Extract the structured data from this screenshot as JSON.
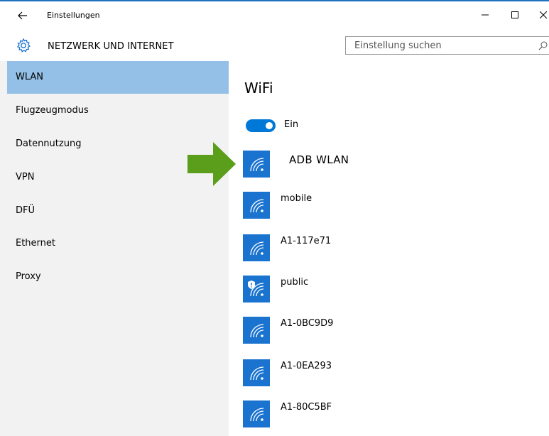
{
  "window": {
    "title": "Einstellungen",
    "minimize_glyph": "–",
    "maximize_glyph": "☐",
    "close_glyph": "✕"
  },
  "header": {
    "section_title": "NETZWERK UND INTERNET",
    "search_placeholder": "Einstellung suchen"
  },
  "sidebar": {
    "items": [
      {
        "label": "WLAN",
        "active": true
      },
      {
        "label": "Flugzeugmodus",
        "active": false
      },
      {
        "label": "Datennutzung",
        "active": false
      },
      {
        "label": "VPN",
        "active": false
      },
      {
        "label": "DFÜ",
        "active": false
      },
      {
        "label": "Ethernet",
        "active": false
      },
      {
        "label": "Proxy",
        "active": false
      }
    ]
  },
  "main": {
    "heading": "WiFi",
    "toggle_label": "Ein",
    "toggle_on": true,
    "networks": [
      {
        "name": "ADB WLAN",
        "secured": true,
        "highlighted": true
      },
      {
        "name": "mobile",
        "secured": true
      },
      {
        "name": "A1-117e71",
        "secured": true
      },
      {
        "name": "public",
        "secured": false,
        "shield": true
      },
      {
        "name": "A1-0BC9D9",
        "secured": true
      },
      {
        "name": "A1-0EA293",
        "secured": true
      },
      {
        "name": "A1-80C5BF",
        "secured": true
      }
    ]
  },
  "colors": {
    "accent": "#0078d7",
    "tile": "#1a73cf",
    "nav_active": "#94c0e7",
    "sidebar_bg": "#f2f2f2",
    "arrow": "#5a9e1c"
  },
  "icons": {
    "back": "back-arrow-icon",
    "settings": "gear-icon",
    "search": "search-icon",
    "network": "wifi-signal-icon",
    "annotation": "green-arrow-icon"
  }
}
